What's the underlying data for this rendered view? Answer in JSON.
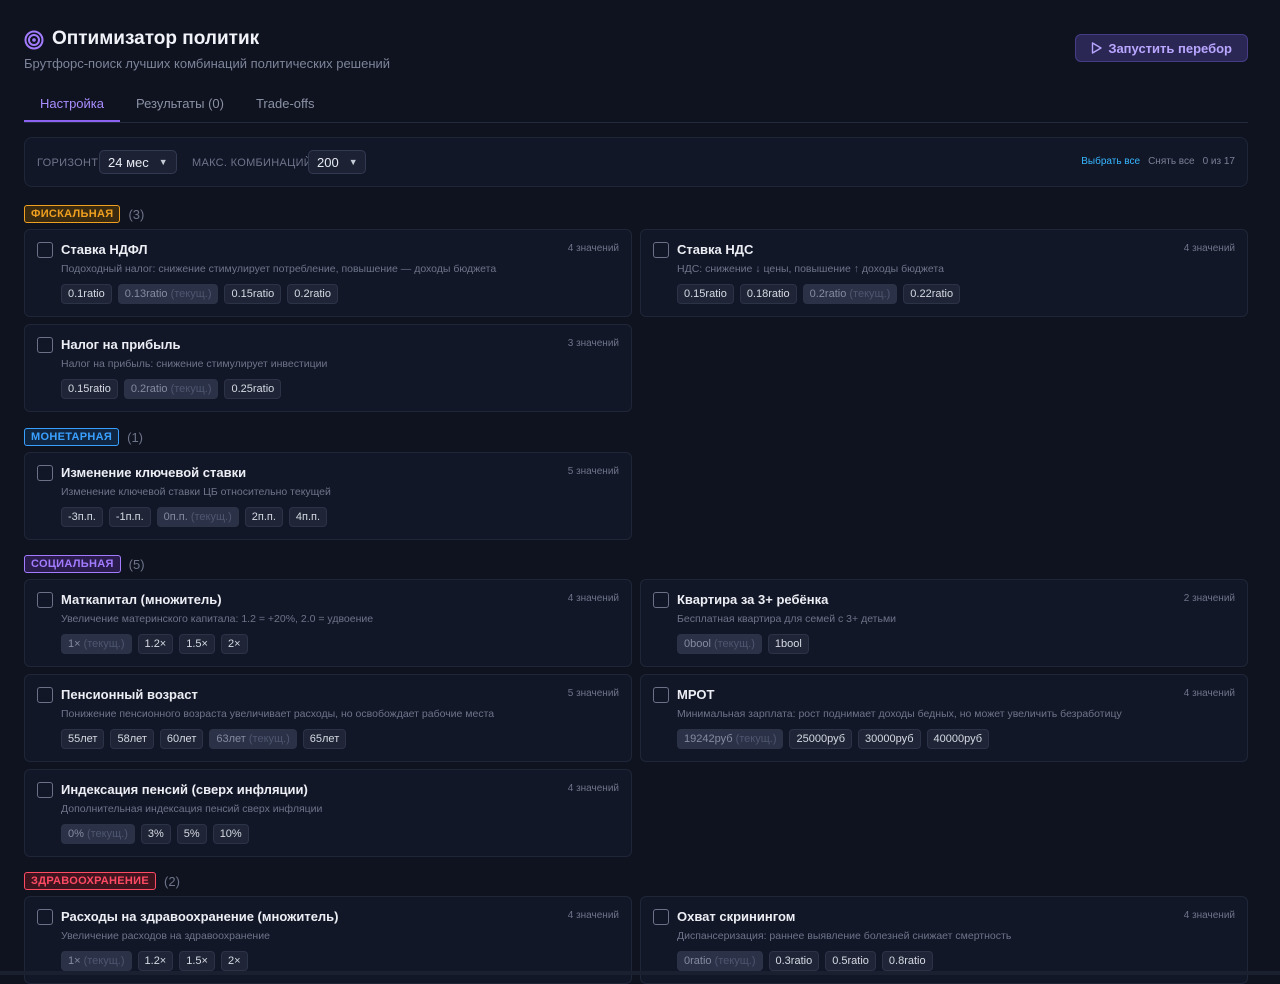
{
  "header": {
    "title": "Оптимизатор политик",
    "subtitle": "Брутфорс-поиск лучших комбинаций политических решений",
    "run_button": "Запустить перебор"
  },
  "tabs": [
    {
      "label": "Настройка",
      "active": true
    },
    {
      "label": "Результаты (0)",
      "active": false
    },
    {
      "label": "Trade-offs",
      "active": false
    }
  ],
  "toolbar": {
    "horizon_label": "ГОРИЗОНТ",
    "horizon_value": "24 мес",
    "max_label": "МАКС. КОМБИНАЦИЙ",
    "max_value": "200",
    "select_all": "Выбрать все",
    "clear_all": "Снять все",
    "selected_count": "0 из 17"
  },
  "current_note": "(текущ.)",
  "categories": [
    {
      "name": "ФИСКАЛЬНАЯ",
      "count": "(3)",
      "color": "#f0a020",
      "bg": "#3a2a10",
      "cards": [
        {
          "title": "Ставка НДФЛ",
          "count": "4 значений",
          "desc": "Подоходный налог: снижение стимулирует потребление, повышение — доходы бюджета",
          "chips": [
            {
              "v": "0.1ratio"
            },
            {
              "v": "0.13ratio",
              "cur": true
            },
            {
              "v": "0.15ratio"
            },
            {
              "v": "0.2ratio"
            }
          ]
        },
        {
          "title": "Ставка НДС",
          "count": "4 значений",
          "desc": "НДС: снижение ↓ цены, повышение ↑ доходы бюджета",
          "chips": [
            {
              "v": "0.15ratio"
            },
            {
              "v": "0.18ratio"
            },
            {
              "v": "0.2ratio",
              "cur": true
            },
            {
              "v": "0.22ratio"
            }
          ]
        },
        {
          "title": "Налог на прибыль",
          "count": "3 значений",
          "desc": "Налог на прибыль: снижение стимулирует инвестиции",
          "chips": [
            {
              "v": "0.15ratio"
            },
            {
              "v": "0.2ratio",
              "cur": true
            },
            {
              "v": "0.25ratio"
            }
          ]
        }
      ]
    },
    {
      "name": "МОНЕТАРНАЯ",
      "count": "(1)",
      "color": "#3aa0ff",
      "bg": "#102640",
      "cards": [
        {
          "title": "Изменение ключевой ставки",
          "count": "5 значений",
          "desc": "Изменение ключевой ставки ЦБ относительно текущей",
          "chips": [
            {
              "v": "-3п.п."
            },
            {
              "v": "-1п.п."
            },
            {
              "v": "0п.п.",
              "cur": true
            },
            {
              "v": "2п.п."
            },
            {
              "v": "4п.п."
            }
          ]
        }
      ]
    },
    {
      "name": "СОЦИАЛЬНАЯ",
      "count": "(5)",
      "color": "#a27bff",
      "bg": "#2a1d4d",
      "cards": [
        {
          "title": "Маткапитал (множитель)",
          "count": "4 значений",
          "desc": "Увеличение материнского капитала: 1.2 = +20%, 2.0 = удвоение",
          "chips": [
            {
              "v": "1×",
              "cur": true
            },
            {
              "v": "1.2×"
            },
            {
              "v": "1.5×"
            },
            {
              "v": "2×"
            }
          ]
        },
        {
          "title": "Квартира за 3+ ребёнка",
          "count": "2 значений",
          "desc": "Бесплатная квартира для семей с 3+ детьми",
          "chips": [
            {
              "v": "0bool",
              "cur": true
            },
            {
              "v": "1bool"
            }
          ]
        },
        {
          "title": "Пенсионный возраст",
          "count": "5 значений",
          "desc": "Понижение пенсионного возраста увеличивает расходы, но освобождает рабочие места",
          "chips": [
            {
              "v": "55лет"
            },
            {
              "v": "58лет"
            },
            {
              "v": "60лет"
            },
            {
              "v": "63лет",
              "cur": true
            },
            {
              "v": "65лет"
            }
          ]
        },
        {
          "title": "МРОТ",
          "count": "4 значений",
          "desc": "Минимальная зарплата: рост поднимает доходы бедных, но может увеличить безработицу",
          "chips": [
            {
              "v": "19242руб",
              "cur": true
            },
            {
              "v": "25000руб"
            },
            {
              "v": "30000руб"
            },
            {
              "v": "40000руб"
            }
          ]
        },
        {
          "title": "Индексация пенсий (сверх инфляции)",
          "count": "4 значений",
          "desc": "Дополнительная индексация пенсий сверх инфляции",
          "chips": [
            {
              "v": "0%",
              "cur": true
            },
            {
              "v": "3%"
            },
            {
              "v": "5%"
            },
            {
              "v": "10%"
            }
          ]
        }
      ]
    },
    {
      "name": "ЗДРАВООХРАНЕНИЕ",
      "count": "(2)",
      "color": "#ff4a64",
      "bg": "#3d141e",
      "cards": [
        {
          "title": "Расходы на здравоохранение (множитель)",
          "count": "4 значений",
          "desc": "Увеличение расходов на здравоохранение",
          "chips": [
            {
              "v": "1×",
              "cur": true
            },
            {
              "v": "1.2×"
            },
            {
              "v": "1.5×"
            },
            {
              "v": "2×"
            }
          ]
        },
        {
          "title": "Охват скринингом",
          "count": "4 значений",
          "desc": "Диспансеризация: раннее выявление болезней снижает смертность",
          "chips": [
            {
              "v": "0ratio",
              "cur": true
            },
            {
              "v": "0.3ratio"
            },
            {
              "v": "0.5ratio"
            },
            {
              "v": "0.8ratio"
            }
          ]
        }
      ]
    }
  ]
}
